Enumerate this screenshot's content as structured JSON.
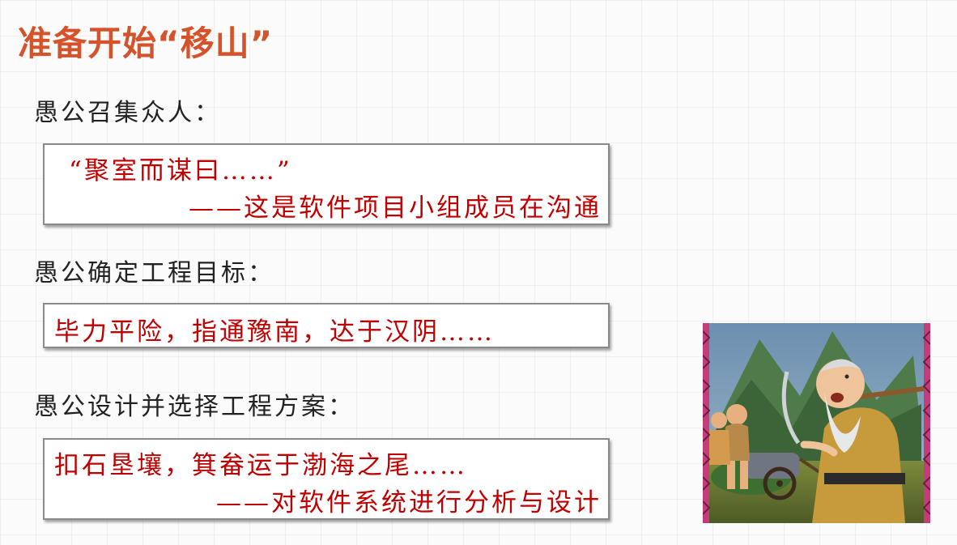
{
  "title": "准备开始“移山”",
  "sections": [
    {
      "label": "愚公召集众人：",
      "lines": [
        "“聚室而谋曰……”",
        "——这是软件项目小组成员在沟通"
      ]
    },
    {
      "label": "愚公确定工程目标：",
      "lines": [
        "毕力平险，指通豫南，达于汉阴……"
      ]
    },
    {
      "label": "愚公设计并选择工程方案：",
      "lines": [
        "扣石垦壤，箕畚运于渤海之尾……",
        "——对软件系统进行分析与设计"
      ]
    }
  ],
  "colors": {
    "title": "#d4532b",
    "quote_text": "#c00000",
    "label_text": "#222222"
  }
}
